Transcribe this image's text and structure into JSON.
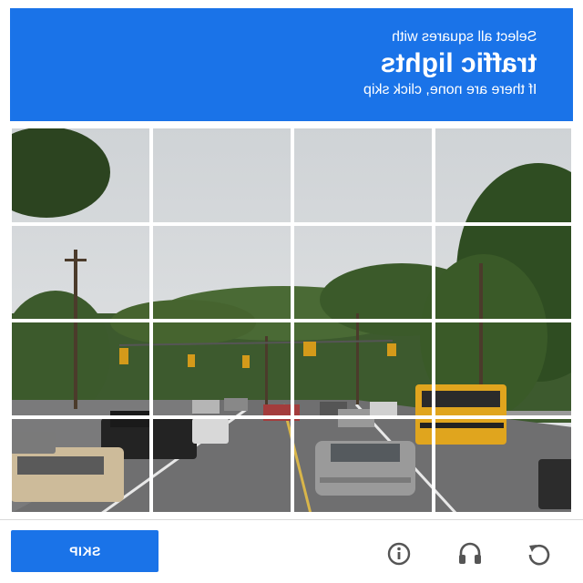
{
  "header": {
    "instruction_small": "Select all squares with",
    "target": "traffic lights",
    "help": "If there are none, click skip",
    "background_color": "#1a73e8"
  },
  "grid": {
    "rows": 4,
    "cols": 4
  },
  "footer": {
    "skip_label": "SKIP",
    "icons": [
      "info-icon",
      "headphones-icon",
      "reload-icon"
    ]
  }
}
